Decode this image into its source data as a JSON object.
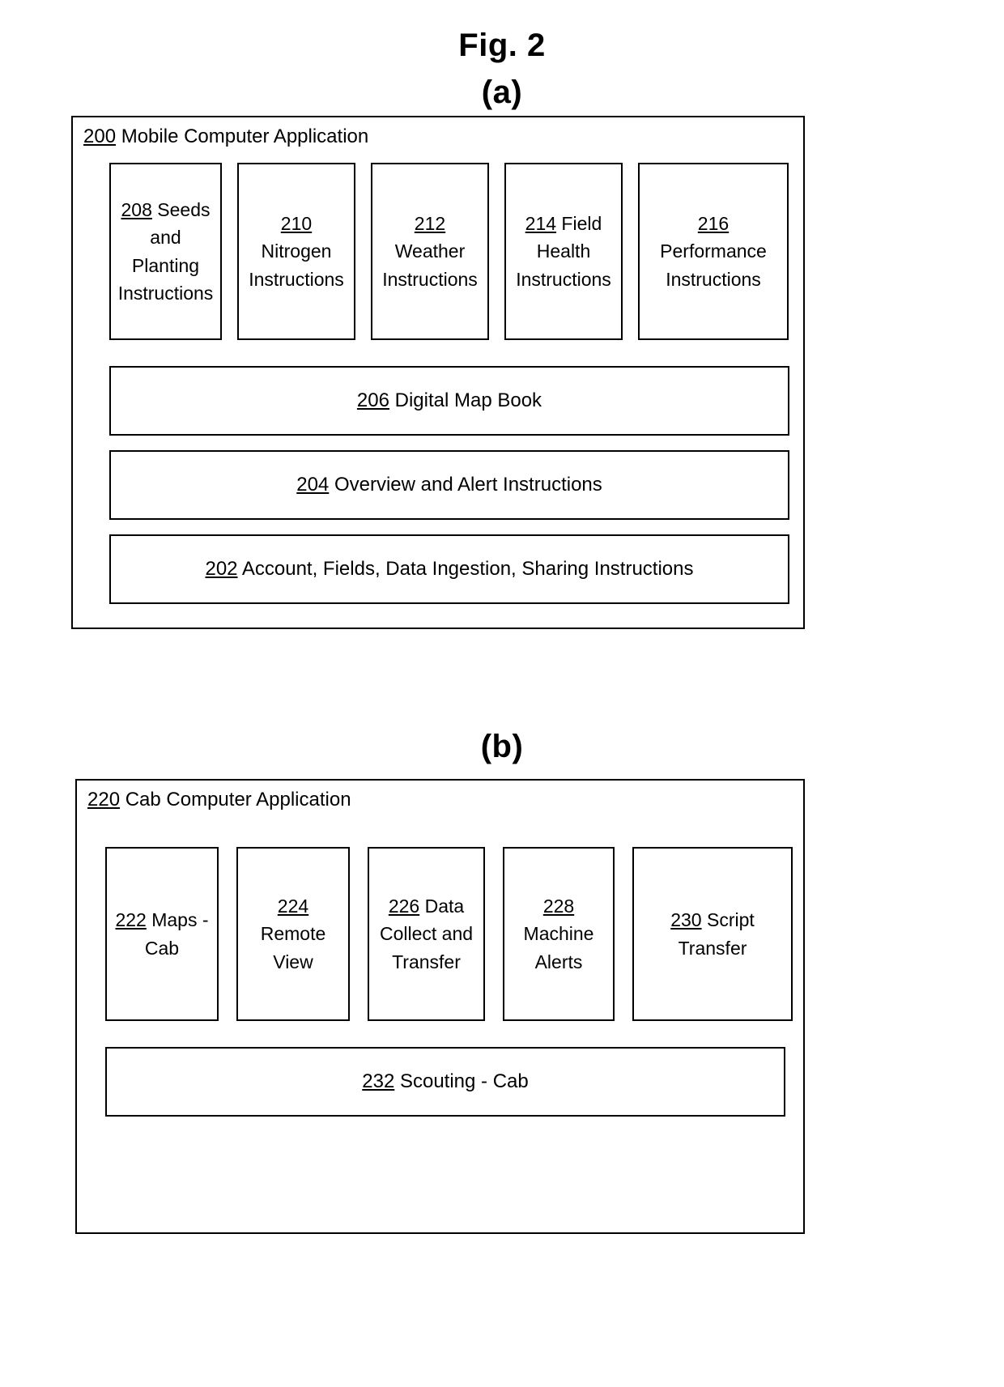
{
  "figure": {
    "title": "Fig. 2",
    "part_a_label": "(a)",
    "part_b_label": "(b)"
  },
  "diagram_a": {
    "container": {
      "ref": "200",
      "title": "Mobile Computer Application"
    },
    "modules": [
      {
        "ref": "208",
        "label": "Seeds and Planting Instructions",
        "line1": "208 Seeds",
        "line2": "and",
        "line3": "Planting",
        "line4": "Instructions"
      },
      {
        "ref": "210",
        "label": "Nitrogen Instructions",
        "line1": "210",
        "line2": "Nitrogen",
        "line3": "Instructions"
      },
      {
        "ref": "212",
        "label": "Weather Instructions",
        "line1": "212",
        "line2": "Weather",
        "line3": "Instructions"
      },
      {
        "ref": "214",
        "label": "Field Health Instructions",
        "line1": "214 Field",
        "line2": "Health",
        "line3": "Instructions"
      },
      {
        "ref": "216",
        "label": "Performance Instructions",
        "line1": "216",
        "line2": "Performance",
        "line3": "Instructions"
      }
    ],
    "bars": [
      {
        "ref": "206",
        "label": "Digital Map Book"
      },
      {
        "ref": "204",
        "label": " Overview and Alert Instructions"
      },
      {
        "ref": "202",
        "label": "Account, Fields, Data Ingestion, Sharing Instructions"
      }
    ]
  },
  "diagram_b": {
    "container": {
      "ref": "220",
      "title": "Cab Computer Application"
    },
    "modules": [
      {
        "ref": "222",
        "label": "Maps - Cab",
        "line1": "222 Maps -",
        "line2": "Cab"
      },
      {
        "ref": "224",
        "label": "Remote View",
        "line1": "224",
        "line2": "Remote",
        "line3": "View"
      },
      {
        "ref": "226",
        "label": "Data Collect and Transfer",
        "line1": "226 Data",
        "line2": "Collect and",
        "line3": "Transfer"
      },
      {
        "ref": "228",
        "label": "Machine Alerts",
        "line1": "228",
        "line2": "Machine",
        "line3": "Alerts"
      },
      {
        "ref": "230",
        "label": "Script Transfer",
        "line1": "230 Script",
        "line2": "Transfer"
      }
    ],
    "bars": [
      {
        "ref": "232",
        "label": "Scouting - Cab"
      }
    ]
  },
  "colors": {
    "line": "#000000",
    "background": "#ffffff"
  }
}
